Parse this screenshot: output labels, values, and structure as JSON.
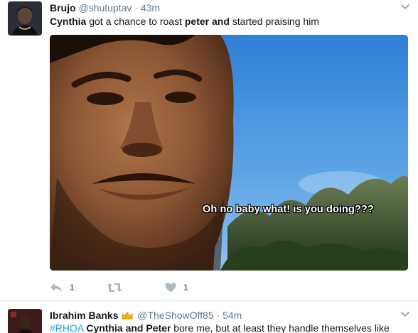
{
  "tweets": [
    {
      "display_name": "Brujo",
      "handle": "@shutuptav",
      "separator": "·",
      "time": "43m",
      "text_parts": [
        "Cynthia",
        " got a chance to roast ",
        "peter and",
        " started praising him"
      ],
      "media_caption": "Oh no baby what! is you doing???",
      "reply_count": "1",
      "like_count": "1"
    },
    {
      "display_name": "Ibrahim Banks",
      "handle": "@TheShowOff85",
      "separator": "·",
      "time": "54m",
      "text_parts": [
        "#RHOA",
        " ",
        "Cynthia and Peter",
        " bore me, but at least they handle themselves like"
      ]
    }
  ],
  "icons": {
    "reply": "reply-icon",
    "retweet": "retweet-icon",
    "like": "heart-icon",
    "menu": "chevron-down-icon",
    "badge": "crown-icon"
  },
  "colors": {
    "link": "#1da1f2",
    "secondary_text": "#657786",
    "action_icon": "#aab8c2"
  }
}
